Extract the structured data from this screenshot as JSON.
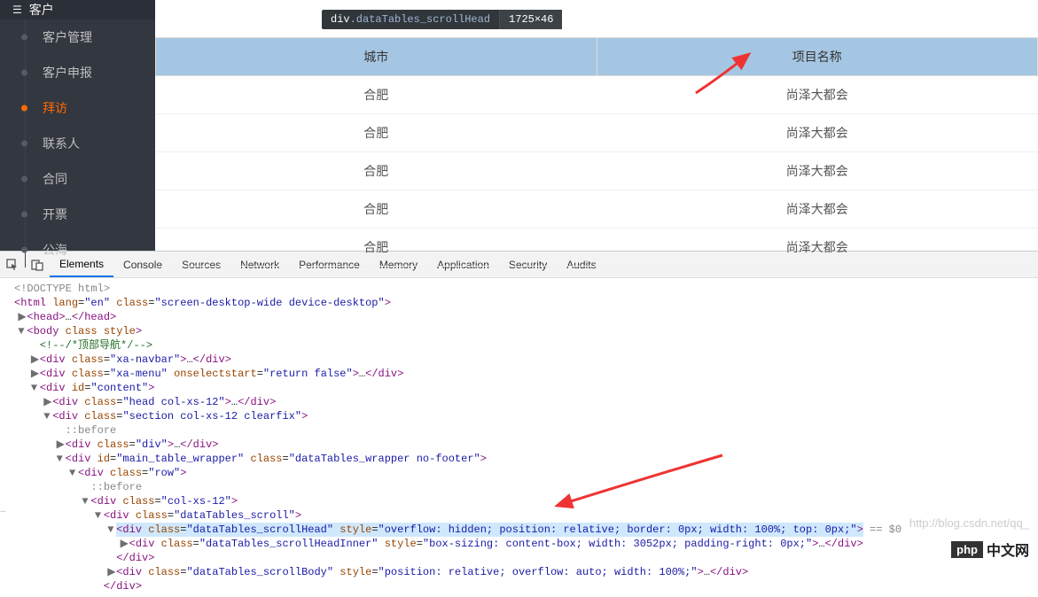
{
  "sidebar": {
    "header_icon": "group-icon",
    "header_label": "客户",
    "items": [
      {
        "label": "客户管理"
      },
      {
        "label": "客户申报"
      },
      {
        "label": "拜访",
        "active": true
      },
      {
        "label": "联系人"
      },
      {
        "label": "合同"
      },
      {
        "label": "开票"
      },
      {
        "label": "公海"
      }
    ]
  },
  "inspect_tip": {
    "selector_prefix": "div",
    "selector_class": ".dataTables_scrollHead",
    "dimensions": "1725×46"
  },
  "table": {
    "headers": [
      "城市",
      "项目名称"
    ],
    "rows": [
      [
        "合肥",
        "尚泽大都会"
      ],
      [
        "合肥",
        "尚泽大都会"
      ],
      [
        "合肥",
        "尚泽大都会"
      ],
      [
        "合肥",
        "尚泽大都会"
      ],
      [
        "合肥",
        "尚泽大都会"
      ]
    ]
  },
  "devtools": {
    "icons": [
      "inspect-icon",
      "device-icon"
    ],
    "tabs": [
      "Elements",
      "Console",
      "Sources",
      "Network",
      "Performance",
      "Memory",
      "Application",
      "Security",
      "Audits"
    ],
    "active_tab": 0
  },
  "dom_lines": [
    {
      "indent": 0,
      "raw": "<!DOCTYPE html>",
      "cls": "gray"
    },
    {
      "indent": 0,
      "html": "<span class='punct'>&lt;</span><span class='tag'>html</span> <span class='attr'>lang</span>=<span class='val'>\"en\"</span> <span class='attr'>class</span>=<span class='val'>\"screen-desktop-wide device-desktop\"</span><span class='punct'>&gt;</span>"
    },
    {
      "indent": 1,
      "collapser": "▶",
      "html": "<span class='punct'>&lt;</span><span class='tag'>head</span><span class='punct'>&gt;</span>…<span class='punct'>&lt;/</span><span class='tag'>head</span><span class='punct'>&gt;</span>"
    },
    {
      "indent": 1,
      "collapser": "▼",
      "html": "<span class='punct'>&lt;</span><span class='tag'>body</span> <span class='attr'>class</span> <span class='attr'>style</span><span class='punct'>&gt;</span>"
    },
    {
      "indent": 2,
      "html": "<span class='comment'>&lt;!--/*顶部导航*/--&gt;</span>"
    },
    {
      "indent": 2,
      "collapser": "▶",
      "html": "<span class='punct'>&lt;</span><span class='tag'>div</span> <span class='attr'>class</span>=<span class='val'>\"xa-navbar\"</span><span class='punct'>&gt;</span>…<span class='punct'>&lt;/</span><span class='tag'>div</span><span class='punct'>&gt;</span>"
    },
    {
      "indent": 2,
      "collapser": "▶",
      "html": "<span class='punct'>&lt;</span><span class='tag'>div</span> <span class='attr'>class</span>=<span class='val'>\"xa-menu\"</span> <span class='attr'>onselectstart</span>=<span class='val'>\"return false\"</span><span class='punct'>&gt;</span>…<span class='punct'>&lt;/</span><span class='tag'>div</span><span class='punct'>&gt;</span>"
    },
    {
      "indent": 2,
      "collapser": "▼",
      "html": "<span class='punct'>&lt;</span><span class='tag'>div</span> <span class='attr'>id</span>=<span class='val'>\"content\"</span><span class='punct'>&gt;</span>"
    },
    {
      "indent": 3,
      "collapser": "▶",
      "html": "<span class='punct'>&lt;</span><span class='tag'>div</span> <span class='attr'>class</span>=<span class='val'>\"head col-xs-12\"</span><span class='punct'>&gt;</span>…<span class='punct'>&lt;/</span><span class='tag'>div</span><span class='punct'>&gt;</span>"
    },
    {
      "indent": 3,
      "collapser": "▼",
      "html": "<span class='punct'>&lt;</span><span class='tag'>div</span> <span class='attr'>class</span>=<span class='val'>\"section col-xs-12 clearfix\"</span><span class='punct'>&gt;</span>"
    },
    {
      "indent": 4,
      "html": "<span class='gray'>::before</span>"
    },
    {
      "indent": 4,
      "collapser": "▶",
      "html": "<span class='punct'>&lt;</span><span class='tag'>div</span> <span class='attr'>class</span>=<span class='val'>\"div\"</span><span class='punct'>&gt;</span>…<span class='punct'>&lt;/</span><span class='tag'>div</span><span class='punct'>&gt;</span>"
    },
    {
      "indent": 4,
      "collapser": "▼",
      "html": "<span class='punct'>&lt;</span><span class='tag'>div</span> <span class='attr'>id</span>=<span class='val'>\"main_table_wrapper\"</span> <span class='attr'>class</span>=<span class='val'>\"dataTables_wrapper no-footer\"</span><span class='punct'>&gt;</span>"
    },
    {
      "indent": 5,
      "collapser": "▼",
      "html": "<span class='punct'>&lt;</span><span class='tag'>div</span> <span class='attr'>class</span>=<span class='val'>\"row\"</span><span class='punct'>&gt;</span>"
    },
    {
      "indent": 6,
      "html": "<span class='gray'>::before</span>"
    },
    {
      "indent": 6,
      "collapser": "▼",
      "html": "<span class='punct'>&lt;</span><span class='tag'>div</span> <span class='attr'>class</span>=<span class='val'>\"col-xs-12\"</span><span class='punct'>&gt;</span>"
    },
    {
      "indent": 7,
      "collapser": "▼",
      "html": "<span class='punct'>&lt;</span><span class='tag'>div</span> <span class='attr'>class</span>=<span class='val'>\"dataTables_scroll\"</span><span class='punct'>&gt;</span>"
    },
    {
      "indent": 8,
      "collapser": "▼",
      "selected": true,
      "html": "<span class='punct'>&lt;</span><span class='tag'>div</span> <span class='attr'>class</span>=<span class='val'>\"dataTables_scrollHead\"</span> <span class='attr'>style</span>=<span class='val'>\"overflow: hidden; position: relative; border: 0px; width: 100%; top: 0px;\"</span><span class='punct'>&gt;</span>",
      "suffix": " == $0"
    },
    {
      "indent": 9,
      "collapser": "▶",
      "html": "<span class='punct'>&lt;</span><span class='tag'>div</span> <span class='attr'>class</span>=<span class='val'>\"dataTables_scrollHeadInner\"</span> <span class='attr'>style</span>=<span class='val'>\"box-sizing: content-box; width: 3052px; padding-right: 0px;\"</span><span class='punct'>&gt;</span>…<span class='punct'>&lt;/</span><span class='tag'>div</span><span class='punct'>&gt;</span>"
    },
    {
      "indent": 8,
      "html": "<span class='punct'>&lt;/</span><span class='tag'>div</span><span class='punct'>&gt;</span>"
    },
    {
      "indent": 8,
      "collapser": "▶",
      "html": "<span class='punct'>&lt;</span><span class='tag'>div</span> <span class='attr'>class</span>=<span class='val'>\"dataTables_scrollBody\"</span> <span class='attr'>style</span>=<span class='val'>\"position: relative; overflow: auto; width: 100%;\"</span><span class='punct'>&gt;</span>…<span class='punct'>&lt;/</span><span class='tag'>div</span><span class='punct'>&gt;</span>"
    },
    {
      "indent": 7,
      "html": "<span class='punct'>&lt;/</span><span class='tag'>div</span><span class='punct'>&gt;</span>"
    }
  ],
  "watermark": "http://blog.csdn.net/qq_",
  "logo": {
    "p1": "php",
    "p2": "中文网"
  }
}
